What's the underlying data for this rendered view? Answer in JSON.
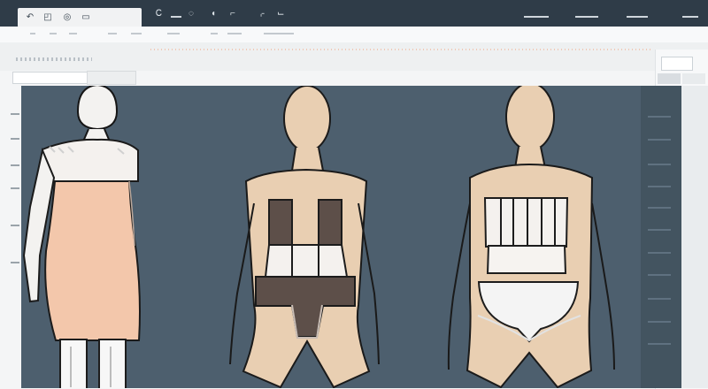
{
  "toolbar": {
    "left_tools": [
      "back-icon",
      "phone-icon",
      "gear-icon",
      "box-icon"
    ],
    "center_tools": [
      "text-tool-icon",
      "line-icon",
      "target-icon",
      "flag-icon",
      "frame-icon",
      "crop-icon",
      "path-icon"
    ],
    "right_tools": [
      "ruler-icon",
      "pen-icon",
      "grid-icon",
      "menu-icon"
    ]
  },
  "panel": {
    "field_value": "",
    "dropdown_label": ""
  },
  "canvas": {
    "figures": [
      {
        "name": "croquis-figure-left-dress",
        "garment": "sheath dress"
      },
      {
        "name": "croquis-figure-center-corset",
        "garment": "corset with bodysuit"
      },
      {
        "name": "croquis-figure-right-bustier",
        "garment": "bustier with briefs"
      }
    ]
  },
  "colors": {
    "toolbar": "#2f3c48",
    "canvas": "#4d5f6e",
    "skin": "#e9cfb2",
    "dress": "#f3c7ab",
    "garment_dark": "#5d4f49",
    "garment_light": "#f4f1ee"
  }
}
